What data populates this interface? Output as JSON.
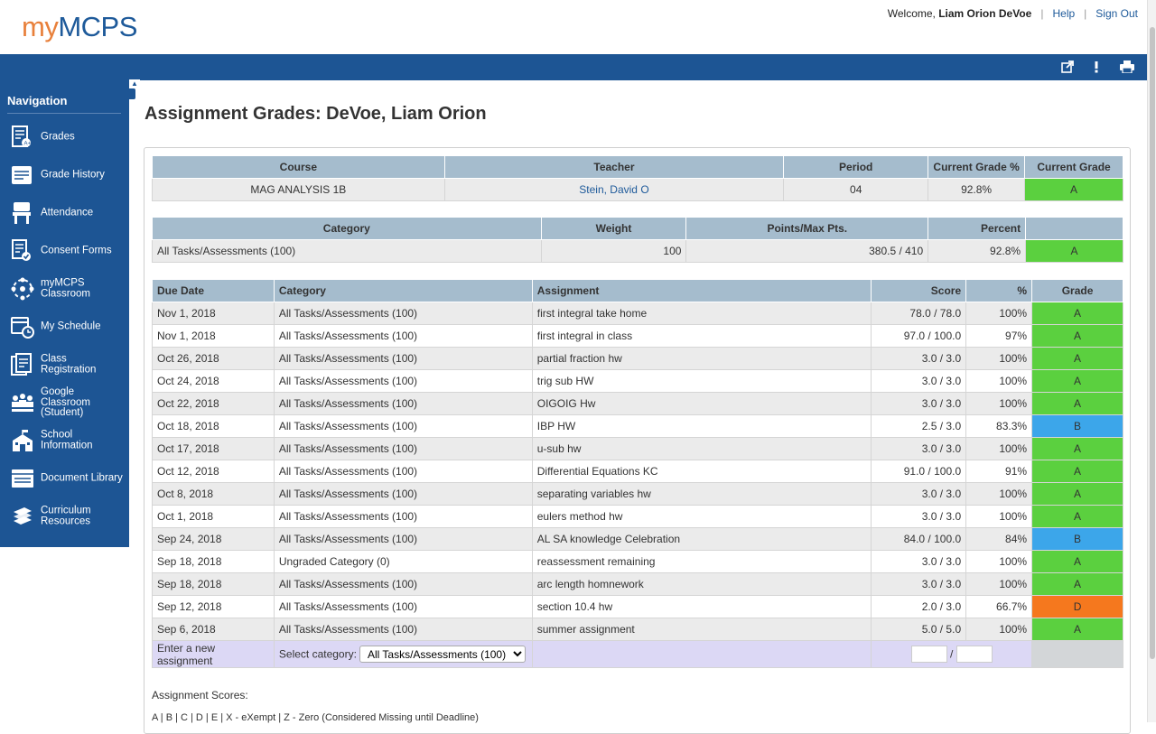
{
  "header": {
    "logo_my": "my",
    "logo_mcps": "MCPS",
    "welcome_prefix": "Welcome, ",
    "user_name": "Liam Orion DeVoe",
    "help": "Help",
    "sign_out": "Sign Out",
    "sep": "|"
  },
  "toolbar": {
    "icons": [
      "external-link-icon",
      "alert-icon",
      "print-icon"
    ]
  },
  "sidebar": {
    "title": "Navigation",
    "items": [
      {
        "label": "Grades",
        "icon": "grades-icon"
      },
      {
        "label": "Grade History",
        "icon": "grade-history-icon"
      },
      {
        "label": "Attendance",
        "icon": "attendance-icon"
      },
      {
        "label": "Consent Forms",
        "icon": "consent-forms-icon"
      },
      {
        "label": "myMCPS Classroom",
        "icon": "classroom-icon"
      },
      {
        "label": "My Schedule",
        "icon": "schedule-icon"
      },
      {
        "label": "Class Registration",
        "icon": "registration-icon"
      },
      {
        "label": "Google Classroom (Student)",
        "icon": "google-classroom-icon"
      },
      {
        "label": "School Information",
        "icon": "school-icon"
      },
      {
        "label": "Document Library",
        "icon": "document-library-icon"
      },
      {
        "label": "Curriculum Resources",
        "icon": "curriculum-icon"
      }
    ]
  },
  "page": {
    "title": "Assignment Grades: DeVoe, Liam Orion"
  },
  "course_table": {
    "headers": [
      "Course",
      "Teacher",
      "Period",
      "Current Grade %",
      "Current Grade"
    ],
    "row": {
      "course": "MAG ANALYSIS 1B",
      "teacher": "Stein, David O",
      "period": "04",
      "grade_pct": "92.8%",
      "grade": "A"
    }
  },
  "category_table": {
    "headers": [
      "Category",
      "Weight",
      "Points/Max Pts.",
      "Percent",
      ""
    ],
    "row": {
      "category": "All Tasks/Assessments (100)",
      "weight": "100",
      "points": "380.5 / 410",
      "percent": "92.8%",
      "grade": "A"
    }
  },
  "assignments_table": {
    "headers": [
      "Due Date",
      "Category",
      "Assignment",
      "Score",
      "%",
      "Grade"
    ],
    "rows": [
      {
        "date": "Nov 1, 2018",
        "category": "All Tasks/Assessments (100)",
        "name": "first integral take home",
        "score": "78.0 / 78.0",
        "pct": "100%",
        "grade": "A"
      },
      {
        "date": "Nov 1, 2018",
        "category": "All Tasks/Assessments (100)",
        "name": "first integral in class",
        "score": "97.0 / 100.0",
        "pct": "97%",
        "grade": "A"
      },
      {
        "date": "Oct 26, 2018",
        "category": "All Tasks/Assessments (100)",
        "name": "partial fraction hw",
        "score": "3.0 / 3.0",
        "pct": "100%",
        "grade": "A"
      },
      {
        "date": "Oct 24, 2018",
        "category": "All Tasks/Assessments (100)",
        "name": "trig sub HW",
        "score": "3.0 / 3.0",
        "pct": "100%",
        "grade": "A"
      },
      {
        "date": "Oct 22, 2018",
        "category": "All Tasks/Assessments (100)",
        "name": "OIGOIG Hw",
        "score": "3.0 / 3.0",
        "pct": "100%",
        "grade": "A"
      },
      {
        "date": "Oct 18, 2018",
        "category": "All Tasks/Assessments (100)",
        "name": "IBP HW",
        "score": "2.5 / 3.0",
        "pct": "83.3%",
        "grade": "B"
      },
      {
        "date": "Oct 17, 2018",
        "category": "All Tasks/Assessments (100)",
        "name": "u-sub hw",
        "score": "3.0 / 3.0",
        "pct": "100%",
        "grade": "A"
      },
      {
        "date": "Oct 12, 2018",
        "category": "All Tasks/Assessments (100)",
        "name": "Differential Equations KC",
        "score": "91.0 / 100.0",
        "pct": "91%",
        "grade": "A"
      },
      {
        "date": "Oct 8, 2018",
        "category": "All Tasks/Assessments (100)",
        "name": "separating variables hw",
        "score": "3.0 / 3.0",
        "pct": "100%",
        "grade": "A"
      },
      {
        "date": "Oct 1, 2018",
        "category": "All Tasks/Assessments (100)",
        "name": "eulers method hw",
        "score": "3.0 / 3.0",
        "pct": "100%",
        "grade": "A"
      },
      {
        "date": "Sep 24, 2018",
        "category": "All Tasks/Assessments (100)",
        "name": "AL SA knowledge Celebration",
        "score": "84.0 / 100.0",
        "pct": "84%",
        "grade": "B"
      },
      {
        "date": "Sep 18, 2018",
        "category": "Ungraded Category (0)",
        "name": "reassessment remaining",
        "score": "3.0 / 3.0",
        "pct": "100%",
        "grade": "A"
      },
      {
        "date": "Sep 18, 2018",
        "category": "All Tasks/Assessments (100)",
        "name": "arc length homnework",
        "score": "3.0 / 3.0",
        "pct": "100%",
        "grade": "A"
      },
      {
        "date": "Sep 12, 2018",
        "category": "All Tasks/Assessments (100)",
        "name": "section 10.4 hw",
        "score": "2.0 / 3.0",
        "pct": "66.7%",
        "grade": "D"
      },
      {
        "date": "Sep 6, 2018",
        "category": "All Tasks/Assessments (100)",
        "name": "summer assignment",
        "score": "5.0 / 5.0",
        "pct": "100%",
        "grade": "A"
      }
    ],
    "new_row": {
      "label": "Enter a new assignment",
      "select_label": "Select category:",
      "select_value": "All Tasks/Assessments (100)",
      "slash": "/"
    }
  },
  "legend": {
    "title": "Assignment Scores:",
    "text": "A | B | C | D | E | X - eXempt | Z - Zero (Considered Missing until Deadline)"
  },
  "colors": {
    "brand_blue": "#1d5594",
    "logo_orange": "#e8803b",
    "grade_A": "#5bd03f",
    "grade_B": "#3ca6ea",
    "grade_D": "#f5781e",
    "header_row": "#a5bccd"
  }
}
